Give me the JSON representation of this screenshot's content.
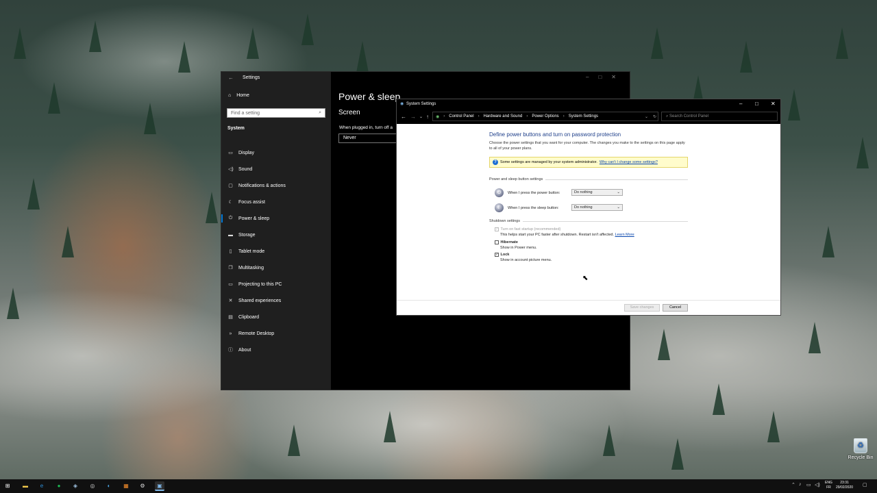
{
  "desktop": {
    "recycle_bin_label": "Recycle Bin"
  },
  "settings_window": {
    "title": "Settings",
    "home_label": "Home",
    "search_placeholder": "Find a setting",
    "section_label": "System",
    "nav_items": [
      {
        "label": "Display",
        "icon": "display-icon",
        "glyph": "▭"
      },
      {
        "label": "Sound",
        "icon": "sound-icon",
        "glyph": "◁)"
      },
      {
        "label": "Notifications & actions",
        "icon": "notifications-icon",
        "glyph": "▢"
      },
      {
        "label": "Focus assist",
        "icon": "focus-assist-icon",
        "glyph": "☾"
      },
      {
        "label": "Power & sleep",
        "icon": "power-icon",
        "glyph": "⏻",
        "active": true
      },
      {
        "label": "Storage",
        "icon": "storage-icon",
        "glyph": "▬"
      },
      {
        "label": "Tablet mode",
        "icon": "tablet-mode-icon",
        "glyph": "▯"
      },
      {
        "label": "Multitasking",
        "icon": "multitasking-icon",
        "glyph": "❐"
      },
      {
        "label": "Projecting to this PC",
        "icon": "projecting-icon",
        "glyph": "▭"
      },
      {
        "label": "Shared experiences",
        "icon": "shared-experiences-icon",
        "glyph": "✕"
      },
      {
        "label": "Clipboard",
        "icon": "clipboard-icon",
        "glyph": "▤"
      },
      {
        "label": "Remote Desktop",
        "icon": "remote-desktop-icon",
        "glyph": "»"
      },
      {
        "label": "About",
        "icon": "about-icon",
        "glyph": "ⓘ"
      }
    ],
    "page_title": "Power & sleep",
    "screen_heading": "Screen",
    "plugged_in_label": "When plugged in, turn off a",
    "plugged_in_value": "Never"
  },
  "system_settings_window": {
    "title": "System Settings",
    "breadcrumbs": [
      "Control Panel",
      "Hardware and Sound",
      "Power Options",
      "System Settings"
    ],
    "search_placeholder": "Search Control Panel",
    "heading": "Define power buttons and turn on password protection",
    "description": "Choose the power settings that you want for your computer. The changes you make to the settings on this page apply to all of your power plans.",
    "info_text": "Some settings are managed by your system administrator.",
    "info_link": "Why can't I change some settings?",
    "button_group_label": "Power and sleep button settings",
    "power_button_label": "When I press the power button:",
    "power_button_value": "Do nothing",
    "sleep_button_label": "When I press the sleep button:",
    "sleep_button_value": "Do nothing",
    "shutdown_group_label": "Shutdown settings",
    "fast_startup": {
      "title": "Turn on fast startup (recommended)",
      "desc": "This helps start your PC faster after shutdown. Restart isn't affected.",
      "link": "Learn More",
      "checked": true,
      "disabled": true
    },
    "hibernate": {
      "title": "Hibernate",
      "desc": "Show in Power menu.",
      "checked": false
    },
    "lock": {
      "title": "Lock",
      "desc": "Show in account picture menu.",
      "checked": true
    },
    "save_label": "Save changes",
    "cancel_label": "Cancel"
  },
  "taskbar": {
    "lang_top": "ENG",
    "lang_bottom": "FR",
    "time": "23:31",
    "date": "29/02/2020"
  }
}
